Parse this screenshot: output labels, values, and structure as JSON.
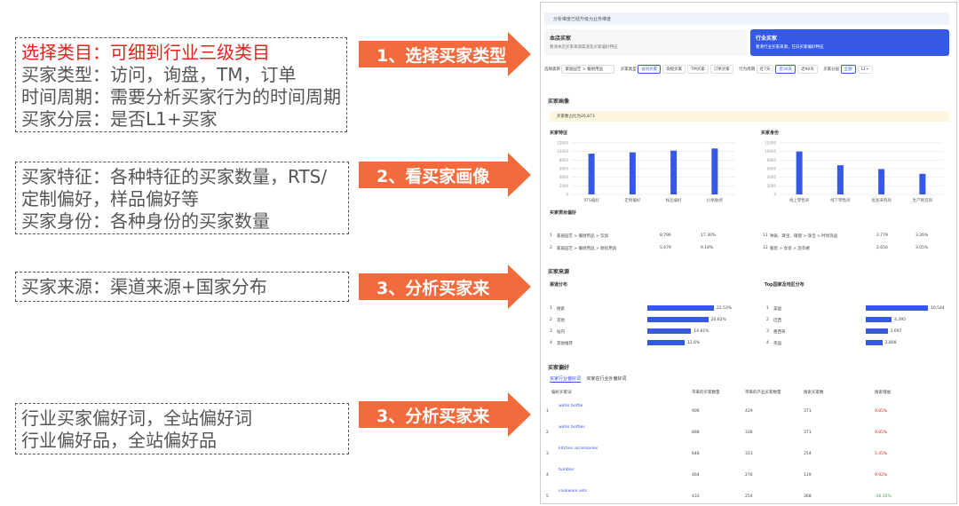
{
  "notes": {
    "n1": {
      "line1": "选择类目：可细到行业三级类目",
      "line2": "买家类型：访问，询盘，TM，订单",
      "line3": "时间周期：需要分析买家行为的时间周期",
      "line4": "买家分层：是否L1+买家"
    },
    "n2": {
      "line1": "买家特征：各种特征的买家数量，RTS/",
      "line2": "定制偏好，样品偏好等",
      "line3": "买家身份：各种身份的买家数量"
    },
    "n3": {
      "line1": "买家来源：渠道来源+国家分布"
    },
    "n4": {
      "line1": "行业买家偏好词，全站偏好词",
      "line2": "行业偏好品，全站偏好品"
    }
  },
  "arrows": [
    "1、选择买家类型",
    "2、看买家画像",
    "3、分析买家来",
    "3、分析买家来"
  ],
  "colors": {
    "accent": "#f36a3d",
    "note_red": "#e8201b",
    "blue": "#3558e6"
  },
  "screenshot": {
    "banner": "分析维度已经升级为业务维度",
    "card_left": {
      "title": "本店买家",
      "sub": "看清本店买家来源渠道及买家偏好特征"
    },
    "card_right": {
      "title": "行业买家",
      "sub": "看清行业买家来源，在向买家偏好特征"
    },
    "filters": {
      "category_label": "选择类目",
      "category_value": "家居园艺 > 餐厨用品",
      "buyer_type_label": "买家类型",
      "buyer_types": [
        "访问买家",
        "询盘买家",
        "TM买家",
        "订单买家"
      ],
      "period_label": "行为周期",
      "periods": [
        "近7天",
        "近30天",
        "近90天"
      ],
      "tier_label": "买家分层",
      "tiers": [
        "全部",
        "L1+"
      ]
    },
    "portrait_title": "买家画像",
    "warning": "买家数占比为26,873",
    "features_title": "买家特征",
    "identity_title": "买家身份",
    "category_title": "买家类目偏好",
    "source_title": "买家来源",
    "channel_title": "渠道分布",
    "country_title": "Top国家及地区分布",
    "preference_title": "买家偏好",
    "tabs": [
      "买家行业偏好词",
      "买家在行业外偏好词"
    ],
    "pref_header": [
      "偏好买家词",
      "带来的买家数量",
      "带来的产品买家数量",
      "搜索买家数",
      "搜索增幅"
    ]
  },
  "chart_data": [
    {
      "type": "bar",
      "title": "买家特征",
      "categories": [
        "RTS偏好",
        "定制偏好",
        "样品偏好",
        "价格敏感"
      ],
      "values": [
        9500,
        9800,
        10200,
        10700
      ],
      "ylim": [
        0,
        12000
      ],
      "yticks": [
        "12000",
        "10000",
        "8000",
        "6000",
        "4000",
        "2000",
        "0"
      ]
    },
    {
      "type": "bar",
      "title": "买家身份",
      "categories": [
        "线上零售商",
        "线下零售商",
        "批发采购商",
        "生产制造商"
      ],
      "values": [
        10000,
        6800,
        5900,
        4800
      ],
      "ylim": [
        0,
        12000
      ],
      "yticks": [
        "12000",
        "10000",
        "8000",
        "6000",
        "4000",
        "2000",
        "0"
      ]
    },
    {
      "type": "table",
      "title": "买家类目偏好",
      "rows": [
        [
          "1",
          "家居园艺 > 餐厨用品 > 饮具",
          "8,796",
          "17.30%",
          "11",
          "钟表、珠宝、眼镜 > 珠宝 > 时尚饰品",
          "2,779",
          "3.26%"
        ],
        [
          "2",
          "家居园艺 > 餐厨用品 > 厨房用具",
          "5,679",
          "9.18%",
          "12",
          "服装 > 女装 > 连衣裙",
          "2,650",
          "3.05%"
        ]
      ]
    },
    {
      "type": "bar",
      "title": "渠道分布",
      "categories": [
        "搜索",
        "其他",
        "站内",
        "其他推荐"
      ],
      "values": [
        22.53,
        20.62,
        14.81,
        12.6
      ],
      "value_labels": [
        "22.53%",
        "20.62%",
        "14.81%",
        "12.6%"
      ]
    },
    {
      "type": "bar",
      "title": "Top国家及地区分布",
      "categories": [
        "美国",
        "巴西",
        "墨西哥",
        "英国"
      ],
      "values": [
        10544,
        4395,
        3697,
        2808
      ],
      "value_labels": [
        "10,544",
        "4,395",
        "3,697",
        "2,808"
      ]
    },
    {
      "type": "table",
      "title": "买家偏好",
      "rows": [
        [
          "1",
          "water bottle",
          "906",
          "429",
          "371",
          "9.85%"
        ],
        [
          "2",
          "water bottles",
          "898",
          "336",
          "371",
          "9.85%"
        ],
        [
          "3",
          "kitchen accessories",
          "648",
          "313",
          "254",
          "5.45%"
        ],
        [
          "4",
          "tumbler",
          "464",
          "276",
          "119",
          "9.92%"
        ],
        [
          "5",
          "cookware sets",
          "433",
          "254",
          "368",
          "-16.35%"
        ]
      ]
    }
  ]
}
